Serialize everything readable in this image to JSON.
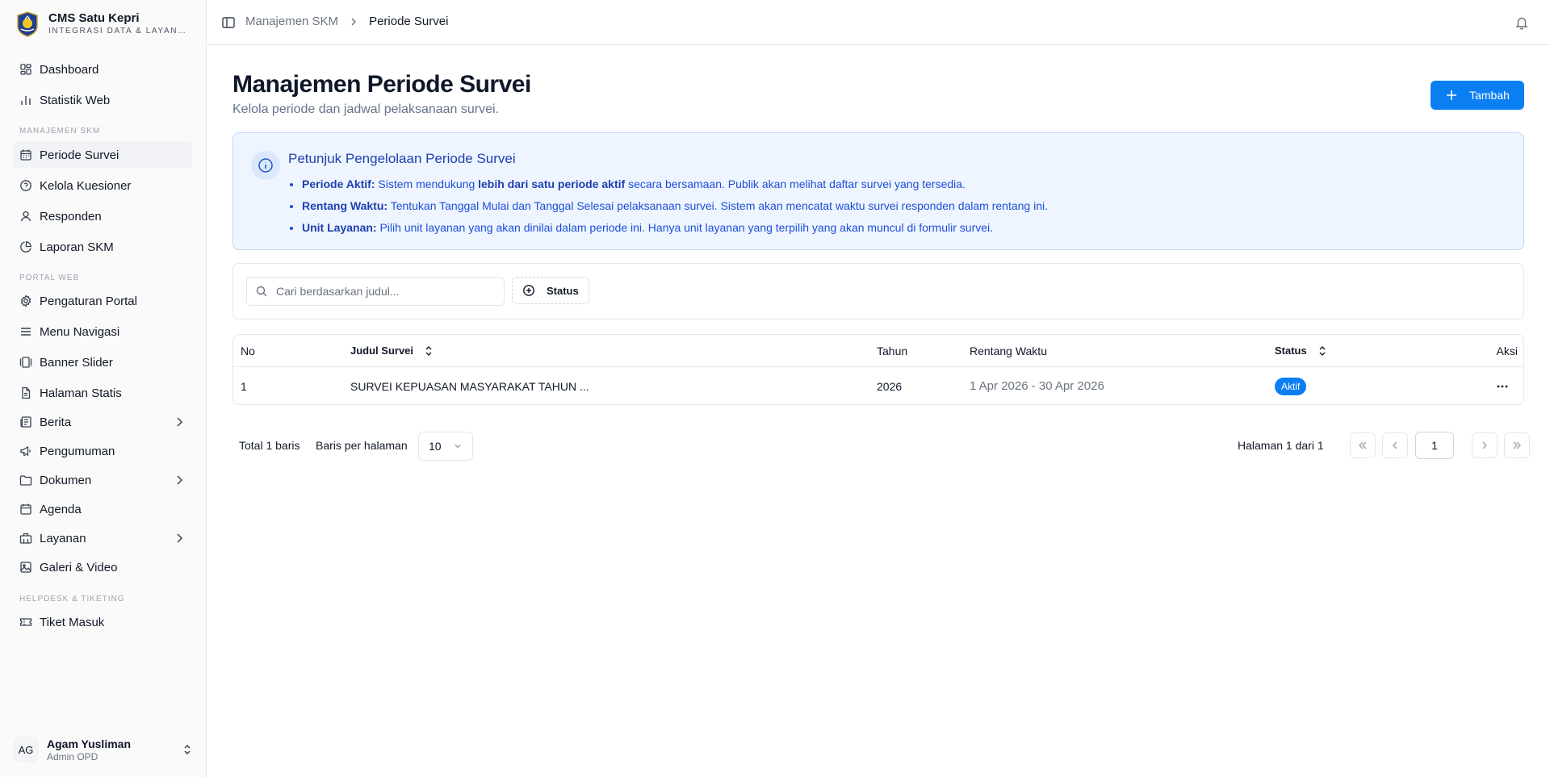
{
  "brand": {
    "name": "CMS Satu Kepri",
    "subtitle": "INTEGRASI DATA & LAYANAN"
  },
  "nav": {
    "top": [
      {
        "label": "Dashboard",
        "icon": "dashboard-icon"
      },
      {
        "label": "Statistik Web",
        "icon": "bar-chart-icon"
      }
    ],
    "section_skm": "MANAJEMEN SKM",
    "skm": [
      {
        "label": "Periode Survei",
        "icon": "calendar-icon",
        "active": true
      },
      {
        "label": "Kelola Kuesioner",
        "icon": "help-circle-icon"
      },
      {
        "label": "Responden",
        "icon": "users-icon"
      },
      {
        "label": "Laporan SKM",
        "icon": "pie-chart-icon"
      }
    ],
    "section_portal": "PORTAL WEB",
    "portal": [
      {
        "label": "Pengaturan Portal",
        "icon": "gear-icon"
      },
      {
        "label": "Menu Navigasi",
        "icon": "menu-icon"
      },
      {
        "label": "Banner Slider",
        "icon": "slider-icon"
      },
      {
        "label": "Halaman Statis",
        "icon": "file-icon"
      },
      {
        "label": "Berita",
        "icon": "newspaper-icon",
        "has_children": true
      },
      {
        "label": "Pengumuman",
        "icon": "megaphone-icon"
      },
      {
        "label": "Dokumen",
        "icon": "folder-icon",
        "has_children": true
      },
      {
        "label": "Agenda",
        "icon": "calendar-icon"
      },
      {
        "label": "Layanan",
        "icon": "building-icon",
        "has_children": true
      },
      {
        "label": "Galeri & Video",
        "icon": "image-icon"
      }
    ],
    "section_helpdesk": "HELPDESK & TIKETING",
    "helpdesk": [
      {
        "label": "Tiket Masuk",
        "icon": "ticket-icon"
      }
    ]
  },
  "user": {
    "initials": "AG",
    "name": "Agam Yusliman",
    "role": "Admin OPD"
  },
  "header": {
    "breadcrumb": [
      "Manajemen SKM",
      "Periode Survei"
    ]
  },
  "page": {
    "title": "Manajemen Periode Survei",
    "subtitle": "Kelola periode dan jadwal pelaksanaan survei.",
    "add_button": "Tambah"
  },
  "info": {
    "title": "Petunjuk Pengelolaan Periode Survei",
    "items": [
      {
        "label": "Periode Aktif:",
        "pre": "Sistem mendukung",
        "bold": "lebih dari satu periode aktif",
        "post": "secara bersamaan. Publik akan melihat daftar survei yang tersedia."
      },
      {
        "label": "Rentang Waktu:",
        "text": "Tentukan Tanggal Mulai dan Tanggal Selesai pelaksanaan survei. Sistem akan mencatat waktu survei responden dalam rentang ini."
      },
      {
        "label": "Unit Layanan:",
        "text": "Pilih unit layanan yang akan dinilai dalam periode ini. Hanya unit layanan yang terpilih yang akan muncul di formulir survei."
      }
    ]
  },
  "filter": {
    "search_placeholder": "Cari berdasarkan judul...",
    "status_label": "Status"
  },
  "table": {
    "headers": {
      "no": "No",
      "judul": "Judul Survei",
      "tahun": "Tahun",
      "rentang": "Rentang Waktu",
      "status": "Status",
      "aksi": "Aksi"
    },
    "rows": [
      {
        "no": "1",
        "judul": "SURVEI KEPUASAN MASYARAKAT TAHUN ...",
        "tahun": "2026",
        "rentang": "1 Apr 2026 - 30 Apr 2026",
        "status": "Aktif"
      }
    ]
  },
  "pagination": {
    "total": "Total 1 baris",
    "rows_per_page_label": "Baris per halaman",
    "rows_per_page": "10",
    "page_info": "Halaman 1 dari 1",
    "current_page": "1"
  },
  "colors": {
    "accent": "#0b7ff2",
    "info_bg": "#eef5ff",
    "info_text": "#1d4ed8"
  }
}
